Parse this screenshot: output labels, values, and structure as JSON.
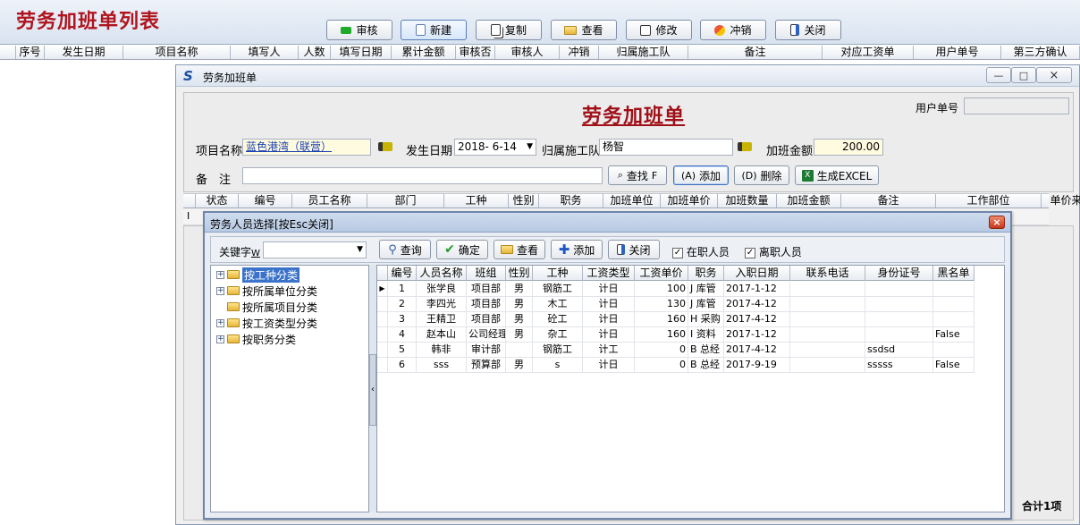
{
  "main": {
    "title": "劳务加班单列表",
    "toolbar": {
      "review": "审核",
      "new": "新建",
      "copy": "复制",
      "view": "查看",
      "modify": "修改",
      "reverse": "冲销",
      "close": "关闭"
    },
    "columns": [
      "序号",
      "发生日期",
      "项目名称",
      "填写人",
      "人数",
      "填写日期",
      "累计金额",
      "审核否",
      "审核人",
      "冲销",
      "归属施工队",
      "备注",
      "对应工资单",
      "用户单号",
      "第三方确认"
    ],
    "total": "合计1项"
  },
  "form_window": {
    "title": "劳务加班单",
    "heading": "劳务加班单",
    "user_no_label": "用户单号",
    "user_no_value": "",
    "project_label": "项目名称",
    "project_value": "蓝色港湾（联营）",
    "date_label": "发生日期",
    "date_value": "2018- 6-14",
    "team_label": "归属施工队",
    "team_value": "杨智",
    "amount_label": "加班金额",
    "amount_value": "200.00",
    "note_label": "备　注",
    "note_value": "",
    "buttons": {
      "find": "查找",
      "find_key": "F",
      "add": "添加",
      "add_key": "(A)",
      "delete": "删除",
      "delete_key": "(D)",
      "excel": "生成EXCEL"
    },
    "columns": [
      "状态",
      "编号",
      "员工名称",
      "部门",
      "工种",
      "性别",
      "职务",
      "加班单位",
      "加班单价",
      "加班数量",
      "加班金额",
      "备注",
      "工作部位",
      "单价来源"
    ],
    "window_controls": {
      "minimize": "—",
      "restore": "□",
      "close": "×"
    }
  },
  "staff_dialog": {
    "title": "劳务人员选择[按Esc关闭]",
    "keyword_label": "关键字",
    "keyword_key": "W",
    "keyword_value": "",
    "buttons": {
      "query": "查询",
      "confirm": "确定",
      "view": "查看",
      "add": "添加",
      "close": "关闭"
    },
    "check_active": "在职人员",
    "check_left": "离职人员",
    "tree": [
      "按工种分类",
      "按所属单位分类",
      "按所属项目分类",
      "按工资类型分类",
      "按职务分类"
    ],
    "columns": [
      "编号",
      "人员名称",
      "班组",
      "性别",
      "工种",
      "工资类型",
      "工资单价",
      "职务",
      "入职日期",
      "联系电话",
      "身份证号",
      "黑名单"
    ],
    "rows": [
      [
        "1",
        "张学良",
        "项目部",
        "男",
        "钢筋工",
        "计日",
        "100",
        "J 库管",
        "2017-1-12",
        "",
        "",
        ""
      ],
      [
        "2",
        "李四光",
        "项目部",
        "男",
        "木工",
        "计日",
        "130",
        "J 库管",
        "2017-4-12",
        "",
        "",
        ""
      ],
      [
        "3",
        "王精卫",
        "项目部",
        "男",
        "砼工",
        "计日",
        "160",
        "H 采购",
        "2017-4-12",
        "",
        "",
        ""
      ],
      [
        "4",
        "赵本山",
        "公司经理",
        "男",
        "杂工",
        "计日",
        "160",
        "I 资料",
        "2017-1-12",
        "",
        "",
        "False"
      ],
      [
        "5",
        "韩非",
        "审计部",
        "",
        "钢筋工",
        "计工",
        "0",
        "B 总经",
        "2017-4-12",
        "",
        "ssdsd",
        ""
      ],
      [
        "6",
        "sss",
        "预算部",
        "男",
        "s",
        "计日",
        "0",
        "B 总经",
        "2017-9-19",
        "",
        "sssss",
        "False"
      ]
    ]
  },
  "colors": {
    "title_red": "#b0141e",
    "selection_blue": "#3a73c9"
  }
}
